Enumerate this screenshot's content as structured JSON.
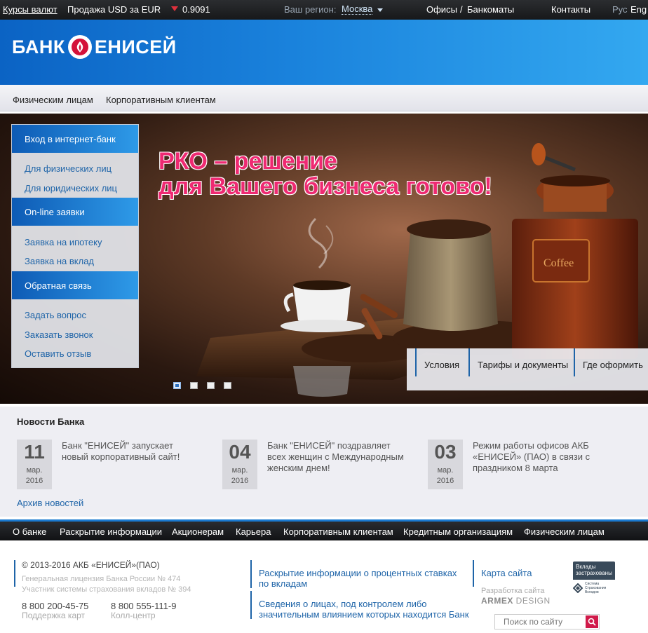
{
  "topbar": {
    "rates_link": "Курсы валют",
    "sale_label": "Продажа USD за EUR",
    "rate_value": "0.9091",
    "trend_icon": "down-arrow-icon",
    "region_label": "Ваш регион:",
    "region_city": "Москва",
    "offices": "Офисы",
    "separator": "/",
    "atms": "Банкоматы",
    "contacts": "Контакты",
    "lang_ru": "Рус",
    "lang_en": "Eng"
  },
  "header": {
    "logo_left": "БАНК",
    "logo_right": "ЕНИСЕЙ"
  },
  "segnav": {
    "items": [
      "Физическим лицам",
      "Корпоративным клиентам"
    ]
  },
  "hero": {
    "slogan_line1": "РКО – решение",
    "slogan_line2": "для Вашего бизнеса готово!",
    "coffee_label": "Coffee",
    "subtabs": [
      "Условия",
      "Тарифы и документы",
      "Где оформить"
    ],
    "slides_count": 4,
    "active_slide": 1
  },
  "sidemenu": {
    "sections": [
      {
        "title": "Вход в интернет-банк",
        "links": [
          "Для физических лиц",
          "Для юридических лиц"
        ]
      },
      {
        "title": "On-line заявки",
        "links": [
          "Заявка на ипотеку",
          "Заявка на вклад"
        ]
      },
      {
        "title": "Обратная связь",
        "links": [
          "Задать вопрос",
          "Заказать звонок",
          "Оставить отзыв"
        ]
      }
    ]
  },
  "news": {
    "title": "Новости Банка",
    "items": [
      {
        "day": "11",
        "month": "мар.",
        "year": "2016",
        "text_lines": [
          "Банк \"ЕНИСЕЙ\" запускает",
          "новый корпоративный сайт!"
        ]
      },
      {
        "day": "04",
        "month": "мар.",
        "year": "2016",
        "text_lines": [
          "Банк \"ЕНИСЕЙ\" поздравляет",
          "всех женщин с Международным",
          "женским днем!"
        ]
      },
      {
        "day": "03",
        "month": "мар.",
        "year": "2016",
        "text_lines": [
          "Режим работы офисов АКБ",
          "«ЕНИСЕЙ» (ПАО) в связи с",
          "праздником 8 марта"
        ]
      }
    ],
    "archive": "Архив новостей"
  },
  "bottom_nav": {
    "items": [
      "О банке",
      "Раскрытие информации",
      "Акционерам",
      "Карьера",
      "Корпоративным клиентам",
      "Кредитным организациям",
      "Физическим лицам"
    ]
  },
  "footer": {
    "copyright": "© 2013-2016 АКБ «ЕНИСЕЙ»(ПАО)",
    "license": "Генеральная лицензия Банка России № 474",
    "insurance": "Участник системы страхования вкладов № 394",
    "phone1": "8 800 200-45-75",
    "phone1_label": "Поддержка карт",
    "phone2": "8 800 555-111-9",
    "phone2_label": "Колл-центр",
    "link1_lines": [
      "Раскрытие информации о процентных ставках",
      "по вкладам"
    ],
    "link2_lines": [
      "Сведения о лицах, под контролем либо",
      "значительным влиянием которых находится Банк"
    ],
    "sitemap": "Карта сайта",
    "dev_label": "Разработка сайта",
    "dev_name_bold": "ARMEX",
    "dev_name_rest": " DESIGN",
    "badge_top": "Вклады застрахованы",
    "badge_bottom": "Система Страхования Вкладов",
    "search_placeholder": "Поиск по сайту",
    "search_icon": "search-icon"
  },
  "colors": {
    "brand_blue": "#1a82dc",
    "accent_red": "#d01a4a",
    "slogan_pink": "#ee2a72",
    "link_blue": "#1e64a8"
  }
}
